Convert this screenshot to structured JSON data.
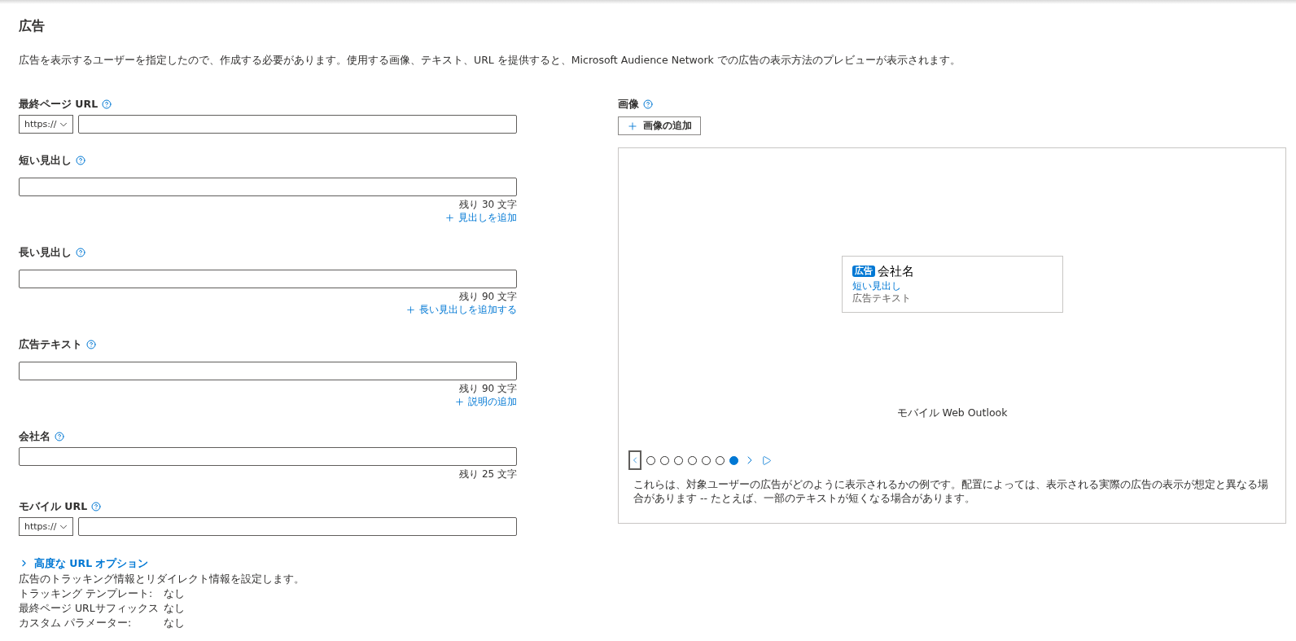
{
  "title": "広告",
  "description": "広告を表示するユーザーを指定したので、作成する必要があります。使用する画像、テキスト、URL を提供すると、Microsoft Audience Network での広告の表示方法のプレビューが表示されます。",
  "fields": [
    {
      "kind": "url",
      "label": "最終ページ URL",
      "protocol": "https://"
    },
    {
      "kind": "text",
      "label": "短い見出し",
      "remaining": "残り 30 文字",
      "add_link": "見出しを追加"
    },
    {
      "kind": "text",
      "label": "長い見出し",
      "remaining": "残り 90 文字",
      "add_link": "長い見出しを追加する"
    },
    {
      "kind": "text",
      "label": "広告テキスト",
      "remaining": "残り 90 文字",
      "add_link": "説明の追加"
    },
    {
      "kind": "text",
      "label": "会社名",
      "remaining": "残り 25 文字"
    },
    {
      "kind": "url",
      "label": "モバイル URL",
      "protocol": "https://"
    }
  ],
  "advanced": {
    "label": "高度な URL オプション",
    "expanded": false,
    "description": "広告のトラッキング情報とリダイレクト情報を設定します。",
    "rows": [
      {
        "name": "トラッキング テンプレート:",
        "value": "なし"
      },
      {
        "name": "最終ページ URLサフィックス",
        "value": "なし"
      },
      {
        "name": "カスタム パラメーター:",
        "value": "なし"
      }
    ]
  },
  "images": {
    "label": "画像",
    "add_button": "画像の追加"
  },
  "preview": {
    "badge": "広告",
    "company": "会社名",
    "headline": "短い見出し",
    "ad_text": "広告テキスト",
    "placement": "モバイル Web Outlook",
    "pages": [
      {
        "selected": false
      },
      {
        "selected": false
      },
      {
        "selected": false
      },
      {
        "selected": false
      },
      {
        "selected": false
      },
      {
        "selected": false
      },
      {
        "selected": true
      }
    ],
    "caption": "これらは、対象ユーザーの広告がどのように表示されるかの例です。配置によっては、表示される実際の広告の表示が想定と異なる場合があります -- たとえば、一部のテキストが短くなる場合があります。"
  }
}
